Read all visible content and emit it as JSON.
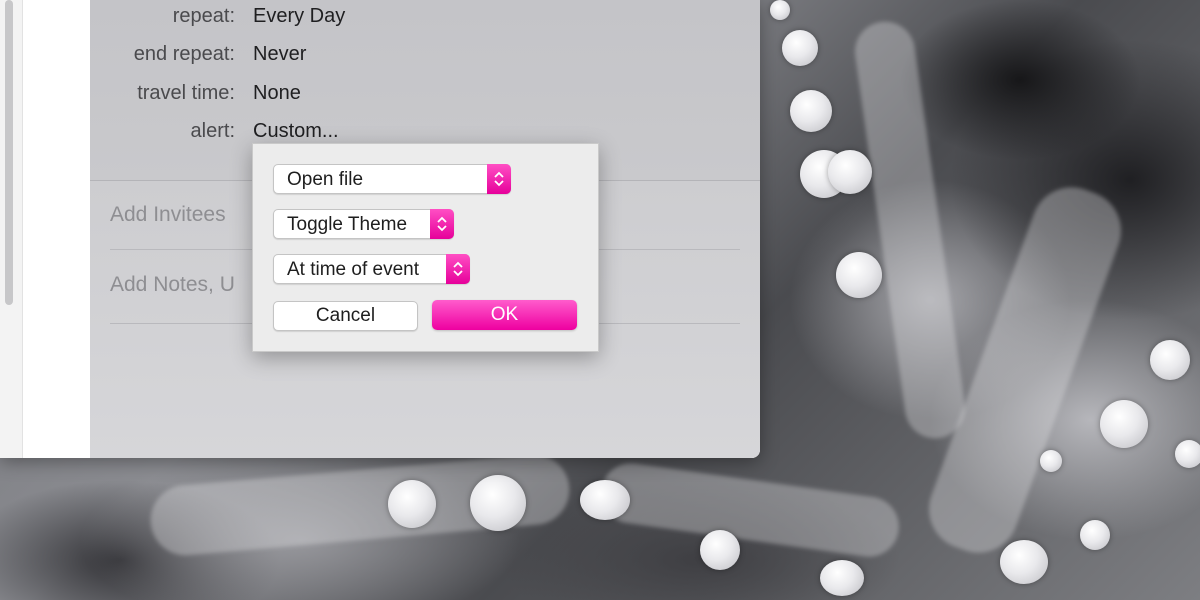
{
  "event_details": {
    "rows": [
      {
        "label": "repeat:",
        "value": "Every Day"
      },
      {
        "label": "end repeat:",
        "value": "Never"
      },
      {
        "label": "travel time:",
        "value": "None"
      },
      {
        "label": "alert:",
        "value": "Custom..."
      }
    ],
    "invitees_placeholder": "Add Invitees",
    "notes_placeholder": "Add Notes, U"
  },
  "alert_dialog": {
    "action_select": "Open file",
    "file_select": "Toggle Theme",
    "timing_select": "At time of event",
    "cancel_label": "Cancel",
    "ok_label": "OK"
  },
  "colors": {
    "accent": "#ee00a0",
    "accent_light": "#ff5ccc"
  },
  "icons": {
    "stepper": "chevron-up-down-icon"
  }
}
